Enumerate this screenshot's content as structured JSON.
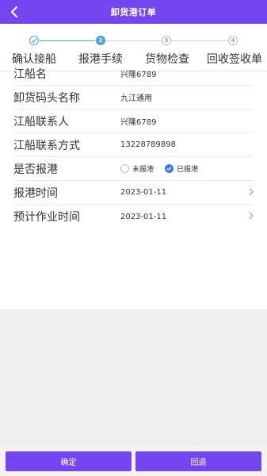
{
  "header": {
    "title": "卸货港订单",
    "bg_color": "#7446f0"
  },
  "stepper": {
    "steps": [
      {
        "label": "确认接船",
        "marker": "",
        "state": "done"
      },
      {
        "label": "报港手续",
        "marker": "2",
        "state": "active"
      },
      {
        "label": "货物检查",
        "marker": "3",
        "state": "todo"
      },
      {
        "label": "回收签收单",
        "marker": "4",
        "state": "todo"
      }
    ],
    "active_color": "#4aa3df",
    "inactive_color": "#bdbdbd"
  },
  "form": {
    "ship_name": {
      "label": "江船名",
      "value": "兴隆6789"
    },
    "dock_name": {
      "label": "卸货码头名称",
      "value": "九江通用"
    },
    "contact": {
      "label": "江船联系人",
      "value": "兴隆6789"
    },
    "phone": {
      "label": "江船联系方式",
      "value": "13228789898"
    },
    "reported": {
      "label": "是否报港",
      "options": [
        {
          "label": "未报港",
          "checked": false
        },
        {
          "label": "已报港",
          "checked": true
        }
      ]
    },
    "report_time": {
      "label": "报港时间",
      "value": "2023-01-11"
    },
    "est_time": {
      "label": "预计作业时间",
      "value": "2023-01-11"
    }
  },
  "actions": {
    "confirm_label": "确定",
    "back_label": "回退"
  }
}
